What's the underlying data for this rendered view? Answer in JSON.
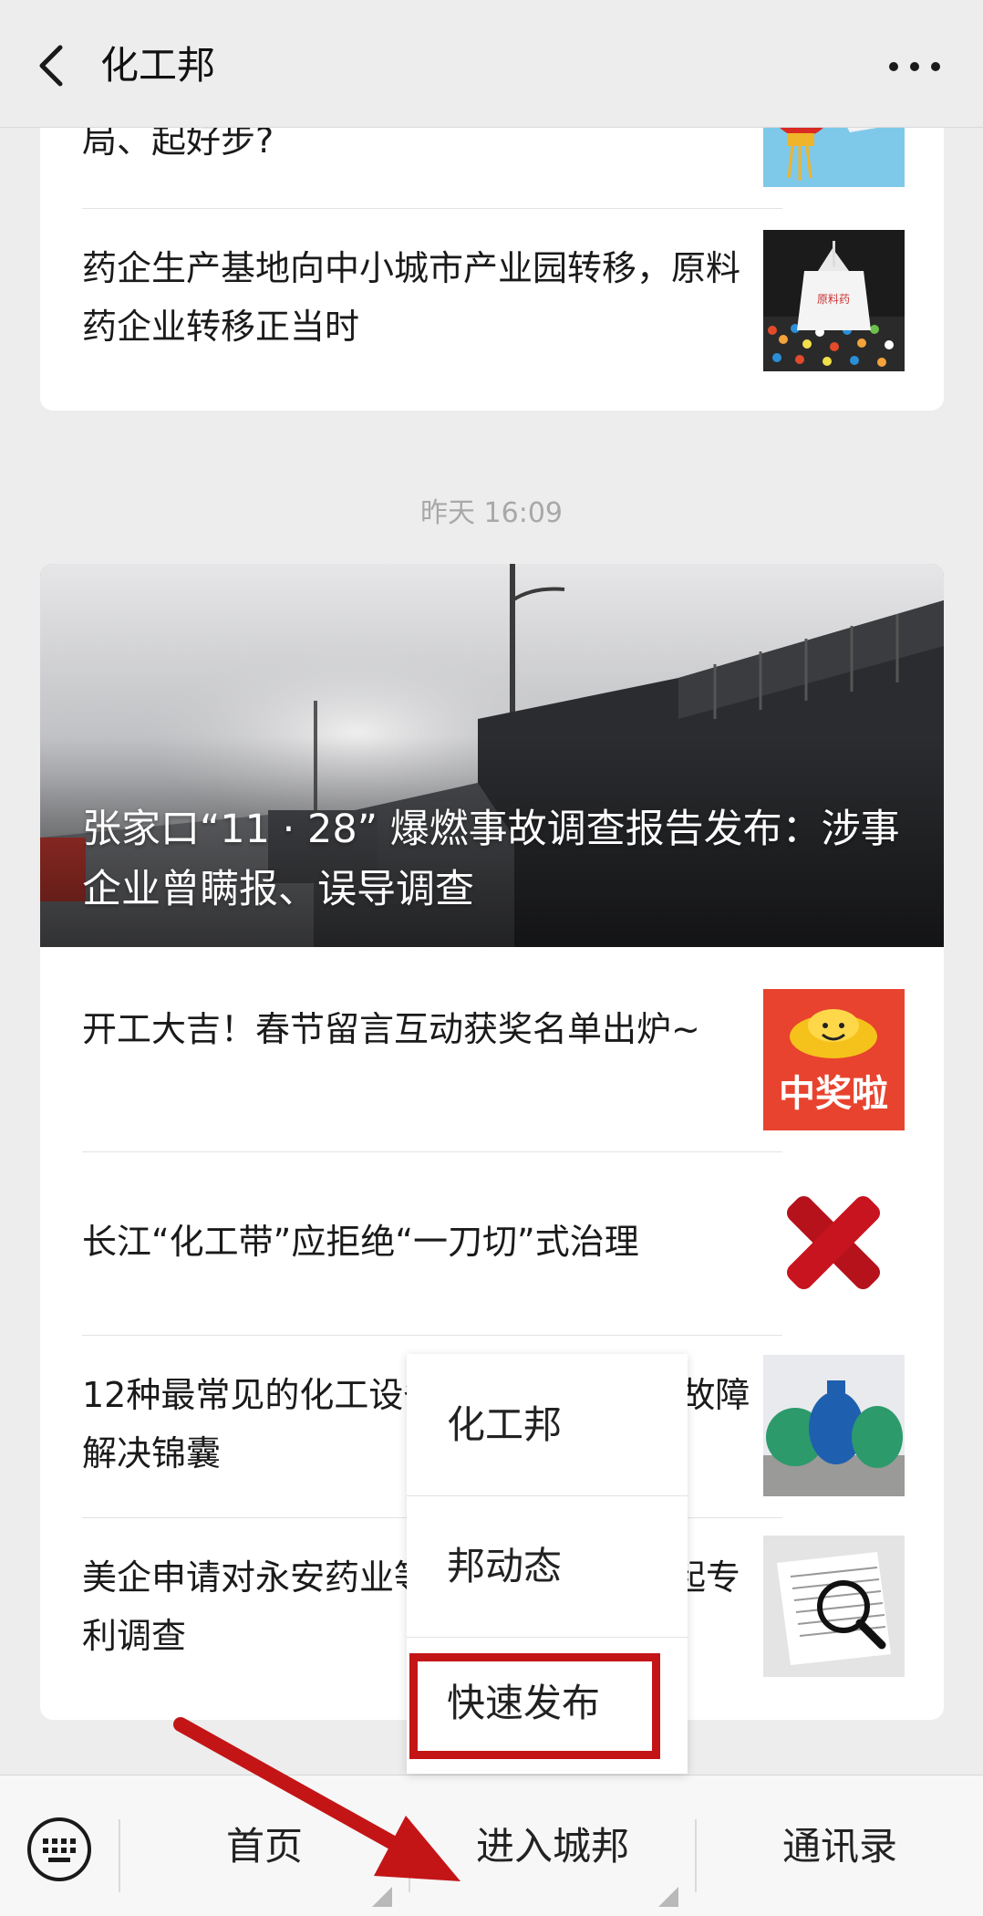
{
  "header": {
    "title": "化工邦"
  },
  "feed1": {
    "items": [
      {
        "text": "局、起好步?"
      },
      {
        "text": "药企生产基地向中小城市产业园转移，原料药企业转移正当时"
      }
    ]
  },
  "timestamp": "昨天 16:09",
  "feed2": {
    "hero_title": "张家口“11 · 28” 爆燃事故调查报告发布：涉事企业曾瞒报、误导调查",
    "items": [
      {
        "text": "开工大吉！春节留言互动获奖名单出炉~"
      },
      {
        "text": "长江“化工带”应拒绝“一刀切”式治理"
      },
      {
        "text": "12种最常见的化工设备故障总结，还有故障解决锦囊"
      },
      {
        "text": "美企申请对永安药业等公司的牛磺酸提起专利调查"
      }
    ],
    "thumb2_text": "中奖啦"
  },
  "popup": {
    "items": [
      "化工邦",
      "邦动态",
      "快速发布"
    ]
  },
  "bottom_menu": {
    "tabs": [
      "首页",
      "进入城邦",
      "通讯录"
    ]
  },
  "colors": {
    "highlight": "#c41516",
    "background": "#ededed"
  }
}
